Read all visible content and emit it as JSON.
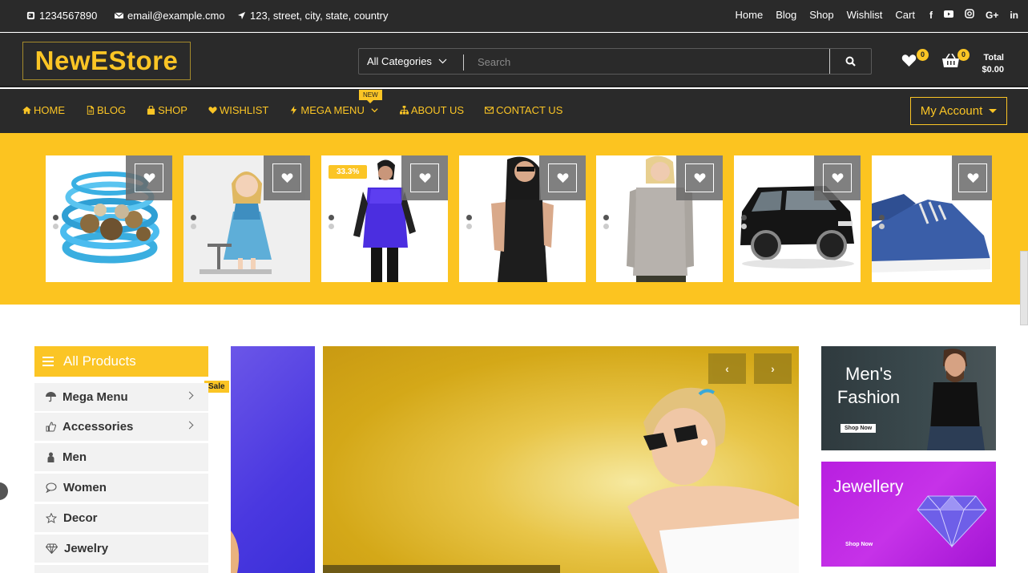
{
  "topbar": {
    "phone": "1234567890",
    "email": "email@example.cmo",
    "address": "123, street, city, state, country",
    "links": [
      "Home",
      "Blog",
      "Shop",
      "Wishlist",
      "Cart"
    ],
    "social": [
      "facebook-icon",
      "youtube-icon",
      "instagram-icon",
      "google-plus-icon",
      "linkedin-icon"
    ]
  },
  "header": {
    "logo": "NewEStore",
    "category_label": "All Categories",
    "search_placeholder": "Search",
    "wishlist_count": "0",
    "cart_count": "0",
    "total_label": "Total",
    "total_value": "$0.00"
  },
  "nav": {
    "items": [
      "HOME",
      "BLOG",
      "SHOP",
      "WISHLIST",
      "MEGA MENU",
      "ABOUT US",
      "CONTACT US"
    ],
    "new_tag": "NEW",
    "account": "My Account"
  },
  "products": {
    "discount": "33.3%"
  },
  "sidebar": {
    "title": "All Products",
    "sale_tag": "Sale",
    "categories": [
      "Mega Menu",
      "Accessories",
      "Men",
      "Women",
      "Decor",
      "Jewelry"
    ]
  },
  "ads": {
    "men_line1": "Men's",
    "men_line2": "Fashion",
    "men_cta": "Shop Now",
    "jewel_title": "Jewellery",
    "jewel_cta": "Shop Now"
  },
  "colors": {
    "accent": "#fbc525",
    "dark": "#2a2a2a"
  }
}
